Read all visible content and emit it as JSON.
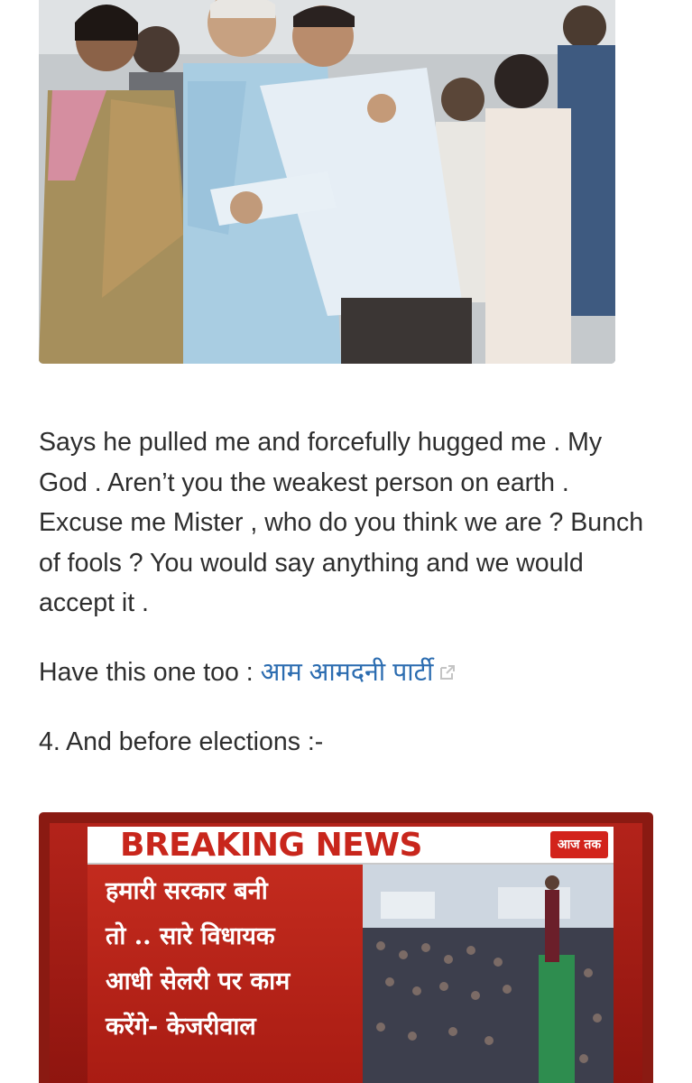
{
  "photo": {
    "alt": "photo"
  },
  "post": {
    "paragraph1": "Says he pulled me and forcefully hugged me . My God . Aren’t you the weakest person on earth . Excuse me Mister , who do you think we are ? Bunch of fools ? You would say anything and we would accept it .",
    "paragraph2_prefix": "Have this one too : ",
    "paragraph2_link": "आम आमदनी पार्टी",
    "paragraph3": "4. And before elections :-"
  },
  "breaking_image": {
    "banner": "BREAKING NEWS",
    "logo": "आज तक",
    "lines": [
      "हमारी सरकार बनी",
      "तो .. सारे विधायक",
      "आधी सेलरी पर काम",
      "करेंगे-  केजरीवाल"
    ]
  },
  "colors": {
    "link": "#2b6cb0",
    "banner_red": "#c8261c"
  }
}
